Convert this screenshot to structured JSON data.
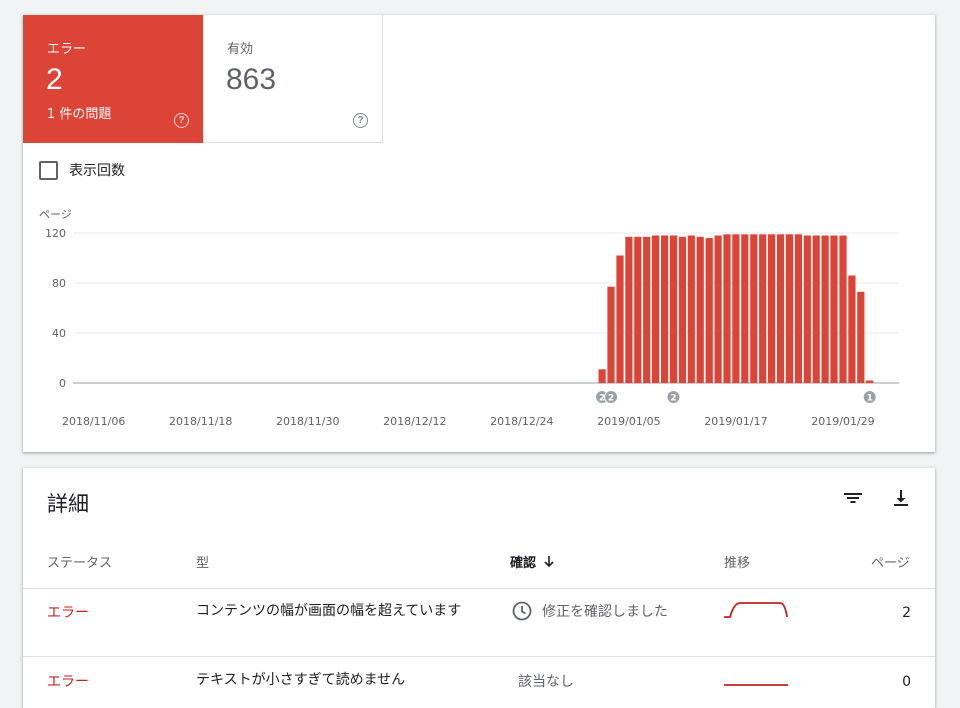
{
  "metrics": {
    "error": {
      "label": "エラー",
      "value": "2",
      "sub": "1 件の問題",
      "help": "?"
    },
    "valid": {
      "label": "有効",
      "value": "863",
      "help": "?"
    }
  },
  "impressions_checkbox": {
    "label": "表示回数",
    "checked": false
  },
  "chart_data": {
    "type": "bar",
    "ylabel": "ページ",
    "ylim": [
      0,
      120
    ],
    "y_ticks": [
      "0",
      "40",
      "80",
      "120"
    ],
    "x_tick_labels": [
      "2018/11/06",
      "2018/11/18",
      "2018/11/30",
      "2018/12/12",
      "2018/12/24",
      "2019/01/05",
      "2019/01/17",
      "2019/01/29"
    ],
    "dates": [
      "2019/01/02",
      "2019/01/03",
      "2019/01/04",
      "2019/01/05",
      "2019/01/06",
      "2019/01/07",
      "2019/01/08",
      "2019/01/09",
      "2019/01/10",
      "2019/01/11",
      "2019/01/12",
      "2019/01/13",
      "2019/01/14",
      "2019/01/15",
      "2019/01/16",
      "2019/01/17",
      "2019/01/18",
      "2019/01/19",
      "2019/01/20",
      "2019/01/21",
      "2019/01/22",
      "2019/01/23",
      "2019/01/24",
      "2019/01/25",
      "2019/01/26",
      "2019/01/27",
      "2019/01/28",
      "2019/01/29",
      "2019/01/30",
      "2019/01/31",
      "2019/02/01"
    ],
    "values": [
      11,
      77,
      102,
      117,
      117,
      117,
      118,
      118,
      118,
      117,
      118,
      117,
      116,
      118,
      119,
      119,
      119,
      119,
      119,
      119,
      119,
      119,
      119,
      118,
      118,
      118,
      118,
      118,
      86,
      73,
      2
    ],
    "color": "#db4437",
    "annotations": [
      {
        "date": "2019/01/02",
        "label": "2"
      },
      {
        "date": "2019/01/03",
        "label": "2"
      },
      {
        "date": "2019/01/10",
        "label": "2"
      },
      {
        "date": "2019/02/01",
        "label": "1"
      }
    ]
  },
  "details": {
    "title": "詳細",
    "filter_icon": "filter-icon",
    "download_icon": "download-icon",
    "columns": {
      "status": "ステータス",
      "type": "型",
      "validation": "確認",
      "trend": "推移",
      "pages": "ページ"
    },
    "rows": [
      {
        "status": "エラー",
        "type": "コンテンツの幅が画面の幅を超えています",
        "validation": "修正を確認しました",
        "validation_icon": "clock-icon",
        "pages": "2"
      },
      {
        "status": "エラー",
        "type": "テキストが小さすぎて読めません",
        "validation": "該当なし",
        "pages": "0"
      }
    ]
  }
}
